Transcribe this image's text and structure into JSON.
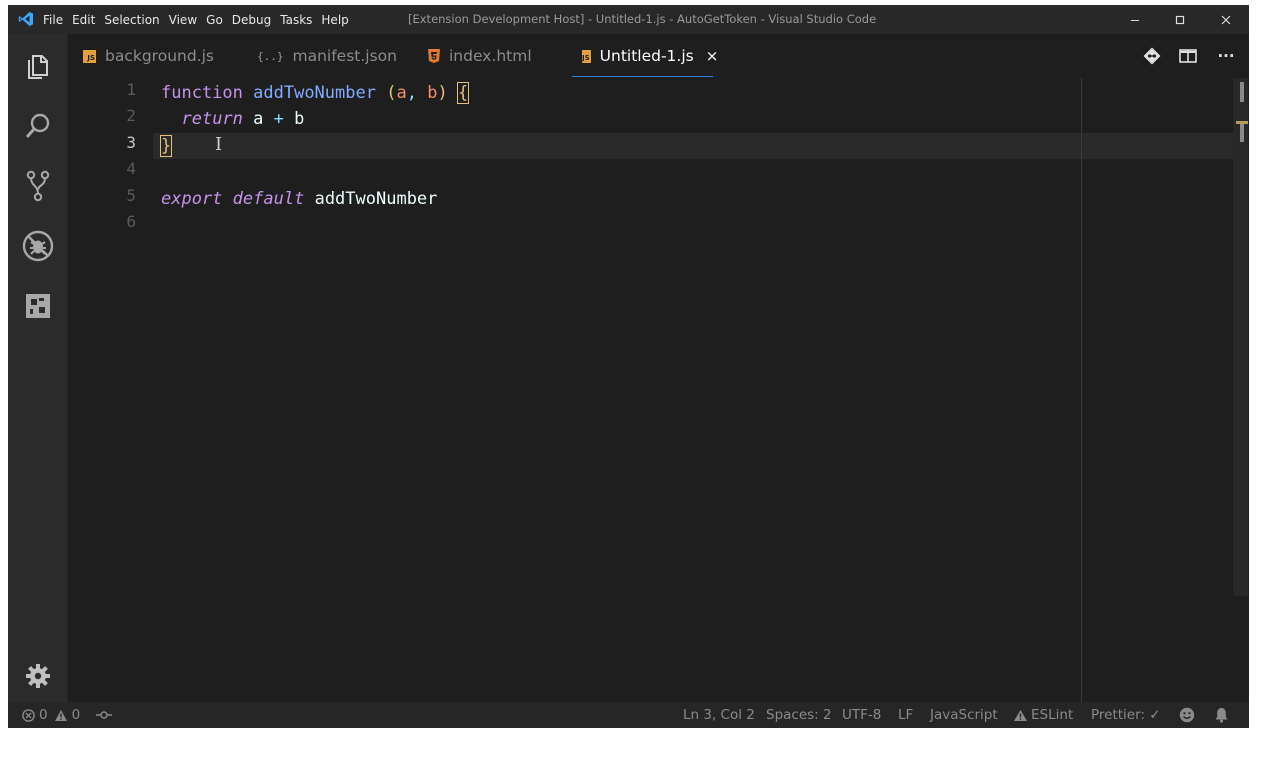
{
  "window": {
    "title": "[Extension Development Host] - Untitled-1.js - AutoGetToken - Visual Studio Code",
    "menu": [
      "File",
      "Edit",
      "Selection",
      "View",
      "Go",
      "Debug",
      "Tasks",
      "Help"
    ],
    "controls": {
      "minimize": "–",
      "maximize": "☐",
      "close": "✕"
    }
  },
  "activity_bar": {
    "items": [
      "explorer-icon",
      "search-icon",
      "source-control-icon",
      "debug-icon",
      "extensions-icon"
    ],
    "bottom": "gear-icon"
  },
  "tabs": [
    {
      "label": "background.js",
      "icon": "js-file-icon",
      "active": false
    },
    {
      "label": "manifest.json",
      "icon": "json-file-icon",
      "json_glyph": "{..}",
      "active": false
    },
    {
      "label": "index.html",
      "icon": "html5-file-icon",
      "active": false
    },
    {
      "label": "Untitled-1.js",
      "icon": "js-file-icon",
      "active": true,
      "close": "×"
    }
  ],
  "file_icon_text": {
    "js": "JS"
  },
  "tab_actions": [
    "git-diff-icon",
    "split-editor-icon",
    "more-actions-icon"
  ],
  "tab_actions_more": "···",
  "editor": {
    "line_numbers": [
      "1",
      "2",
      "3",
      "4",
      "5",
      "6"
    ],
    "current_line": "3",
    "code": {
      "l1": {
        "kw": "function",
        "name": "addTwoNumber",
        "p_open": "(",
        "a": "a",
        "comma": ",",
        "b": "b",
        "p_close": ")",
        "brace": "{"
      },
      "l2": {
        "kw": "return",
        "a": "a",
        "op": "+",
        "b": "b"
      },
      "l3": {
        "brace": "}"
      },
      "l5": {
        "kw1": "export",
        "kw2": "default",
        "name": "addTwoNumber"
      }
    },
    "cursor_glyph": "I"
  },
  "statusbar": {
    "errors": "0",
    "warnings": "0",
    "position": "Ln 3, Col 2",
    "spaces": "Spaces: 2",
    "encoding": "UTF-8",
    "eol": "LF",
    "language": "JavaScript",
    "eslint": "ESLint",
    "prettier": "Prettier: ✓"
  },
  "colors": {
    "keyword": "#c792ea",
    "function": "#82aaff",
    "paren": "#e6c07b",
    "param": "#f78c6c",
    "tab_active_border": "#2f7fe0",
    "js_icon": "#e2a03f",
    "html_icon": "#e37933"
  }
}
